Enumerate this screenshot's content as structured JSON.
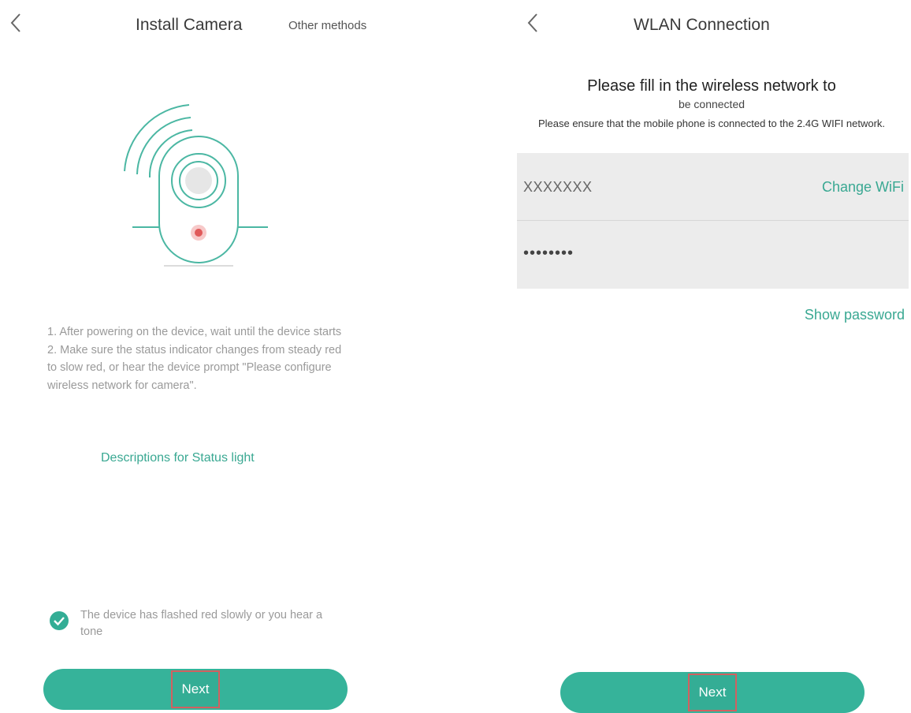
{
  "left_screen": {
    "title": "Install Camera",
    "other_methods": "Other methods",
    "instructions": [
      "1. After powering on the device, wait until the device starts",
      "2. Make sure the status indicator changes from steady red to slow red, or hear the device prompt \"Please configure wireless network for camera\"."
    ],
    "status_link": "Descriptions for Status light",
    "checkbox_checked": true,
    "checkbox_text": "The device has flashed red slowly or you hear a tone",
    "next_label": "Next"
  },
  "right_screen": {
    "title": "WLAN Connection",
    "heading": "Please fill in the wireless network to",
    "subheading": "be connected",
    "note": "Please ensure that the mobile phone is connected to the 2.4G WIFI network.",
    "ssid_value": "XXXXXXX",
    "change_wifi": "Change WiFi",
    "password_value": "••••••••",
    "show_password": "Show password",
    "next_label": "Next"
  },
  "colors": {
    "accent": "#36b39a",
    "link": "#39a892",
    "highlight_box": "#d26060",
    "indicator_red": "#e05a5a"
  },
  "icons": [
    "back-chevron-icon",
    "check-circle-icon",
    "camera-illustration"
  ]
}
